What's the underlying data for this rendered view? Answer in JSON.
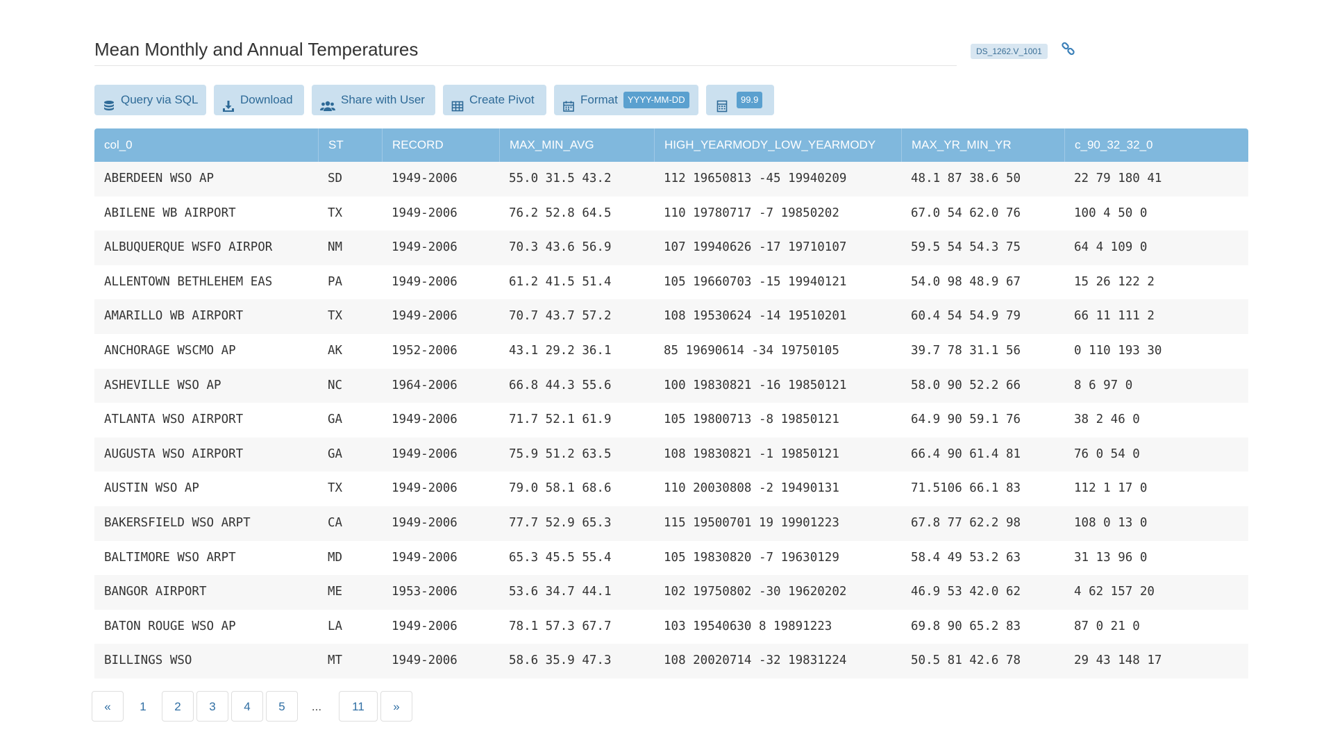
{
  "header": {
    "title": "Mean Monthly and Annual Temperatures",
    "dataset_badge": "DS_1262.V_1001",
    "link_icon": "link-icon"
  },
  "toolbar": {
    "query_label": "Query via SQL",
    "download_label": "Download",
    "share_label": "Share with User",
    "pivot_label": "Create Pivot",
    "format_label": "Format",
    "format_value": "YYYY-MM-DD",
    "number_format_value": "99.9"
  },
  "table": {
    "columns": [
      "col_0",
      "ST",
      "RECORD",
      "MAX_MIN_AVG",
      "HIGH_YEARMODY_LOW_YEARMODY",
      "MAX_YR_MIN_YR",
      "c_90_32_32_0"
    ],
    "rows": [
      [
        "ABERDEEN WSO AP",
        "SD",
        "1949-2006",
        "55.0 31.5 43.2",
        "112 19650813 -45 19940209",
        "48.1 87 38.6 50",
        "22 79 180 41"
      ],
      [
        "ABILENE WB AIRPORT",
        "TX",
        "1949-2006",
        "76.2 52.8 64.5",
        "110 19780717 -7 19850202",
        "67.0 54 62.0 76",
        "100 4 50 0"
      ],
      [
        "ALBUQUERQUE WSFO AIRPOR",
        "NM",
        "1949-2006",
        "70.3 43.6 56.9",
        "107 19940626 -17 19710107",
        "59.5 54 54.3 75",
        "64 4 109 0"
      ],
      [
        "ALLENTOWN BETHLEHEM EAS",
        "PA",
        "1949-2006",
        "61.2 41.5 51.4",
        "105 19660703 -15 19940121",
        "54.0 98 48.9 67",
        "15 26 122 2"
      ],
      [
        "AMARILLO WB AIRPORT",
        "TX",
        "1949-2006",
        "70.7 43.7 57.2",
        "108 19530624 -14 19510201",
        "60.4 54 54.9 79",
        "66 11 111 2"
      ],
      [
        "ANCHORAGE WSCMO AP",
        "AK",
        "1952-2006",
        "43.1 29.2 36.1",
        "85 19690614 -34 19750105",
        "39.7 78 31.1 56",
        "0 110 193 30"
      ],
      [
        "ASHEVILLE WSO AP",
        "NC",
        "1964-2006",
        "66.8 44.3 55.6",
        "100 19830821 -16 19850121",
        "58.0 90 52.2 66",
        "8 6 97 0"
      ],
      [
        "ATLANTA WSO AIRPORT",
        "GA",
        "1949-2006",
        "71.7 52.1 61.9",
        "105 19800713 -8 19850121",
        "64.9 90 59.1 76",
        "38 2 46 0"
      ],
      [
        "AUGUSTA WSO AIRPORT",
        "GA",
        "1949-2006",
        "75.9 51.2 63.5",
        "108 19830821 -1 19850121",
        "66.4 90 61.4 81",
        "76 0 54 0"
      ],
      [
        "AUSTIN WSO AP",
        "TX",
        "1949-2006",
        "79.0 58.1 68.6",
        "110 20030808 -2 19490131",
        "71.5106 66.1 83",
        "112 1 17 0"
      ],
      [
        "BAKERSFIELD WSO ARPT",
        "CA",
        "1949-2006",
        "77.7 52.9 65.3",
        "115 19500701 19 19901223",
        "67.8 77 62.2 98",
        "108 0 13 0"
      ],
      [
        "BALTIMORE WSO ARPT",
        "MD",
        "1949-2006",
        "65.3 45.5 55.4",
        "105 19830820 -7 19630129",
        "58.4 49 53.2 63",
        "31 13 96 0"
      ],
      [
        "BANGOR AIRPORT",
        "ME",
        "1953-2006",
        "53.6 34.7 44.1",
        "102 19750802 -30 19620202",
        "46.9 53 42.0 62",
        "4 62 157 20"
      ],
      [
        "BATON ROUGE WSO AP",
        "LA",
        "1949-2006",
        "78.1 57.3 67.7",
        "103 19540630 8 19891223",
        "69.8 90 65.2 83",
        "87 0 21 0"
      ],
      [
        "BILLINGS WSO",
        "MT",
        "1949-2006",
        "58.6 35.9 47.3",
        "108 20020714 -32 19831224",
        "50.5 81 42.6 78",
        "29 43 148 17"
      ]
    ]
  },
  "pagination": {
    "prev": "«",
    "pages": [
      "1",
      "2",
      "3",
      "4",
      "5"
    ],
    "ellipsis": "...",
    "last": "11",
    "next": "»"
  }
}
